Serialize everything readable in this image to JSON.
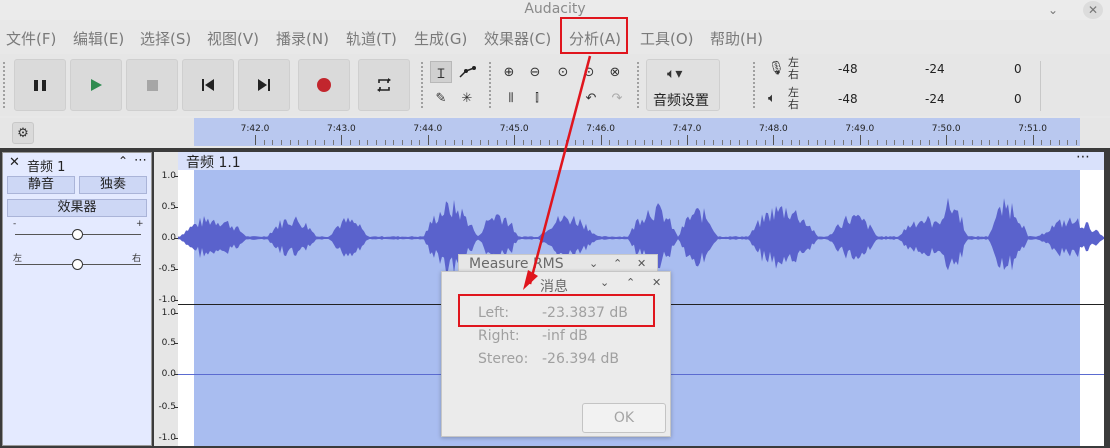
{
  "window": {
    "title": "Audacity",
    "minimize": "⌄",
    "close": "✕"
  },
  "menu": {
    "items": [
      {
        "label": "文件(F)"
      },
      {
        "label": "编辑(E)"
      },
      {
        "label": "选择(S)"
      },
      {
        "label": "视图(V)"
      },
      {
        "label": "播录(N)"
      },
      {
        "label": "轨道(T)"
      },
      {
        "label": "生成(G)"
      },
      {
        "label": "效果器(C)"
      },
      {
        "label": "分析(A)"
      },
      {
        "label": "工具(O)"
      },
      {
        "label": "帮助(H)"
      }
    ]
  },
  "transport": {
    "buttons": [
      "pause-icon",
      "play-icon",
      "stop-icon",
      "skip-to-start-icon",
      "skip-to-end-icon",
      "record-icon",
      "loop-icon"
    ],
    "colors": {
      "play": "#2e8b4f",
      "record": "#c2262d"
    }
  },
  "tools": [
    "selection-tool-icon",
    "envelope-tool-icon",
    "draw-tool-icon",
    "multi-tool-icon"
  ],
  "edit_tools": [
    "zoom-in-icon",
    "zoom-out-icon",
    "fit-selection-icon",
    "fit-project-icon",
    "zoom-toggle-icon",
    "trim-icon",
    "silence-icon",
    "undo-icon",
    "redo-icon"
  ],
  "audio_setup": {
    "label": "音频设置",
    "icon": "speaker-icon",
    "caret": "▾"
  },
  "meters": {
    "record": {
      "lr": [
        "左",
        "右"
      ],
      "ticks": [
        "-48",
        "-24",
        "0"
      ]
    },
    "playback": {
      "lr": [
        "左",
        "右"
      ],
      "ticks": [
        "-48",
        "-24",
        "0"
      ]
    }
  },
  "timeline": {
    "labels": [
      "7:42.0",
      "7:43.0",
      "7:44.0",
      "7:45.0",
      "7:46.0",
      "7:47.0",
      "7:48.0",
      "7:49.0",
      "7:50.0",
      "7:51.0"
    ]
  },
  "track": {
    "name": "音频 1",
    "mute": "静音",
    "solo": "独奏",
    "effects": "效果器",
    "gain_minus": "-",
    "gain_plus": "+",
    "pan_left": "左",
    "pan_right": "右",
    "clip_title": "音频 1.1",
    "scale_top": [
      "1.0",
      "0.5",
      "0.0",
      "-0.5",
      "-1.0"
    ],
    "scale_bottom": [
      "1.0",
      "0.5",
      "0.0",
      "-0.5",
      "-1.0"
    ],
    "colors": {
      "waveform": "#5a62cc",
      "selection": "#a9bdf0",
      "track_bg": "#e4eaff"
    }
  },
  "dialog_rms": {
    "title": "Measure RMS"
  },
  "dialog_msg": {
    "title": "消息",
    "rows": [
      {
        "key": "Left:",
        "value": "-23.3837 dB"
      },
      {
        "key": "Right:",
        "value": "-inf dB"
      },
      {
        "key": "Stereo:",
        "value": "-26.394 dB"
      }
    ],
    "ok": "OK"
  },
  "annotation_color": "#e0151d"
}
